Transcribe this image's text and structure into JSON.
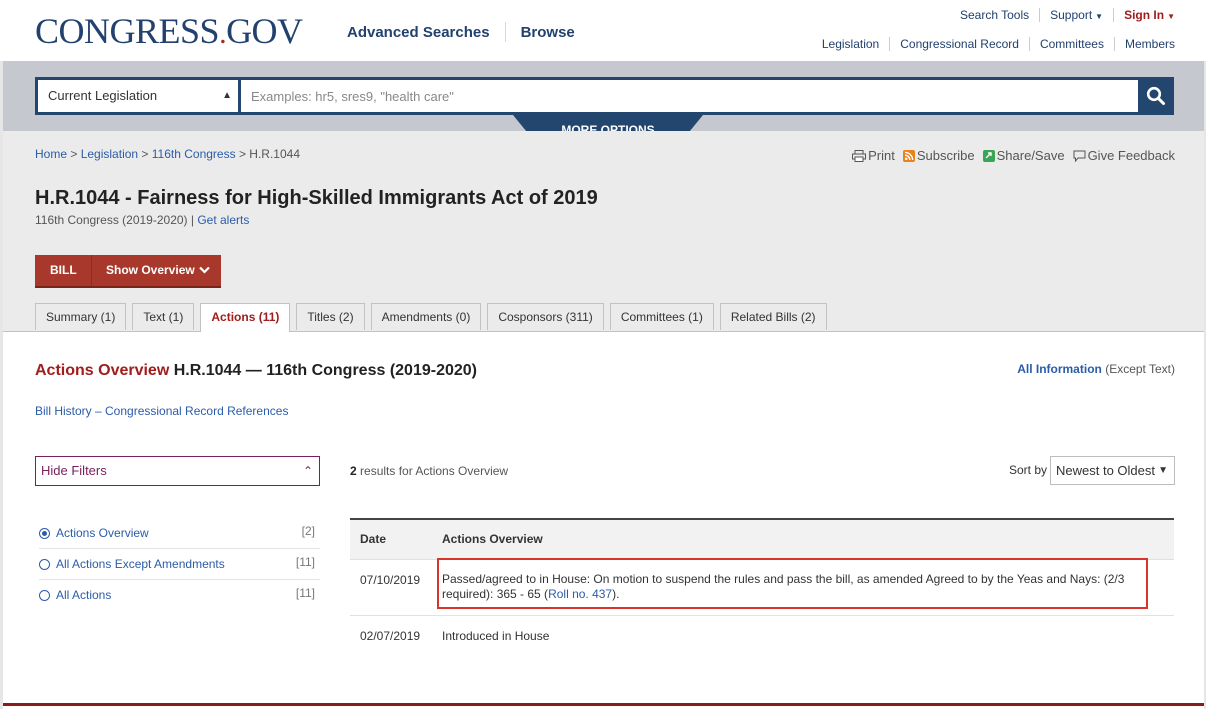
{
  "header": {
    "logo_main": "CONGRESS",
    "logo_dot": ".",
    "logo_tld": "GOV",
    "nav": [
      "Advanced Searches",
      "Browse"
    ],
    "top_links": [
      "Search Tools",
      "Support",
      "Sign In"
    ],
    "sub_links": [
      "Legislation",
      "Congressional Record",
      "Committees",
      "Members"
    ]
  },
  "search": {
    "scope": "Current Legislation",
    "placeholder": "Examples: hr5, sres9, \"health care\"",
    "more_options": "MORE OPTIONS"
  },
  "breadcrumb": {
    "home": "Home",
    "legislation": "Legislation",
    "congress": "116th Congress",
    "current": "H.R.1044",
    "sep": " > "
  },
  "tools": [
    "Print",
    "Subscribe",
    "Share/Save",
    "Give Feedback"
  ],
  "bill": {
    "title": "H.R.1044 - Fairness for High-Skilled Immigrants Act of 2019",
    "congress_line": "116th Congress (2019-2020) | ",
    "get_alerts": "Get alerts",
    "bill_label": "BILL",
    "show_overview": "Show Overview"
  },
  "tabs": [
    "Summary (1)",
    "Text (1)",
    "Actions (11)",
    "Titles (2)",
    "Amendments (0)",
    "Cosponsors (311)",
    "Committees (1)",
    "Related Bills (2)"
  ],
  "overview": {
    "title_red": "Actions Overview",
    "title_rest": " H.R.1044 — 116th Congress (2019-2020)",
    "all_info": "All Information",
    "except_text": " (Except Text)",
    "bill_history": "Bill History – Congressional Record References"
  },
  "filters": {
    "hide_label": "Hide Filters",
    "items": [
      {
        "label": "Actions Overview",
        "count": "[2]"
      },
      {
        "label": "All Actions Except Amendments",
        "count": "[11]"
      },
      {
        "label": "All Actions",
        "count": "[11]"
      }
    ]
  },
  "results": {
    "count": "2",
    "suffix": " results for Actions Overview",
    "sort_label": "Sort by",
    "sort_value": "Newest to Oldest"
  },
  "table": {
    "col_date": "Date",
    "col_overview": "Actions Overview",
    "rows": [
      {
        "date": "07/10/2019",
        "text_a": "Passed/agreed to in House: On motion to suspend the rules and pass the bill, as amended Agreed to by the Yeas and Nays: (2/3",
        "text_b": "required): 365 - 65 (",
        "link": "Roll no. 437",
        "text_c": ")."
      },
      {
        "date": "02/07/2019",
        "text": "Introduced in House"
      }
    ]
  }
}
